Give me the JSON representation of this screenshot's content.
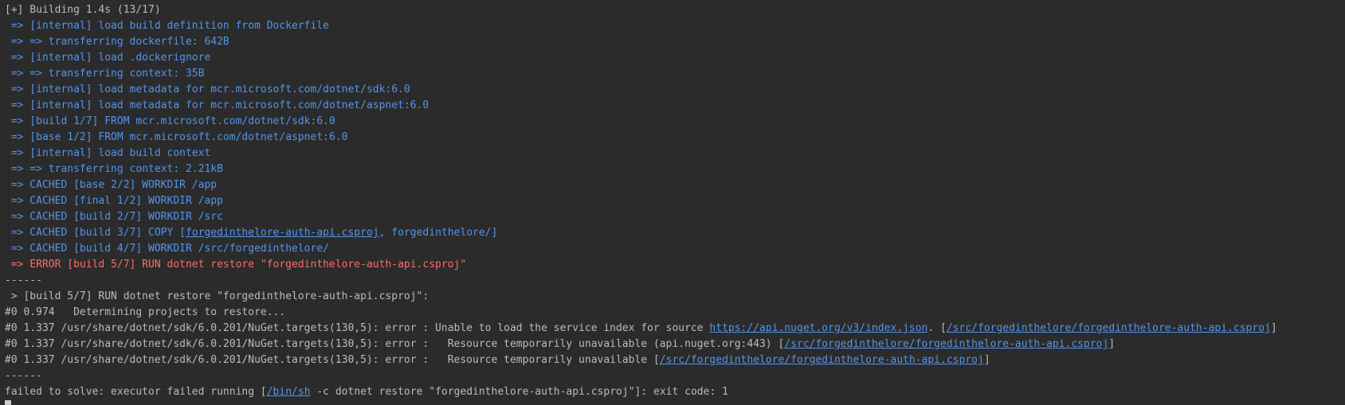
{
  "terminal": {
    "clipped_top": {
      "text": "",
      "link_stub": "",
      "tail": ""
    },
    "header": "[+] Building 1.4s (13/17)",
    "steps": [
      " => [internal] load build definition from Dockerfile",
      " => => transferring dockerfile: 642B",
      " => [internal] load .dockerignore",
      " => => transferring context: 35B",
      " => [internal] load metadata for mcr.microsoft.com/dotnet/sdk:6.0",
      " => [internal] load metadata for mcr.microsoft.com/dotnet/aspnet:6.0",
      " => [build 1/7] FROM mcr.microsoft.com/dotnet/sdk:6.0",
      " => [base 1/2] FROM mcr.microsoft.com/dotnet/aspnet:6.0",
      " => [internal] load build context",
      " => => transferring context: 2.21kB",
      " => CACHED [base 2/2] WORKDIR /app",
      " => CACHED [final 1/2] WORKDIR /app",
      " => CACHED [build 2/7] WORKDIR /src"
    ],
    "copy_step": {
      "prefix": " => CACHED [build 3/7] COPY [",
      "link": "forgedinthelore-auth-api.csproj",
      "suffix": ", forgedinthelore/]"
    },
    "step_workdir": " => CACHED [build 4/7] WORKDIR /src/forgedinthelore/",
    "error_step": " => ERROR [build 5/7] RUN dotnet restore \"forgedinthelore-auth-api.csproj\"",
    "separator": "------",
    "detail_header": " > [build 5/7] RUN dotnet restore \"forgedinthelore-auth-api.csproj\":",
    "detail_line1": "#0 0.974   Determining projects to restore...",
    "detail_line2": {
      "prefix": "#0 1.337 /usr/share/dotnet/sdk/6.0.201/NuGet.targets(130,5): error : Unable to load the service index for source ",
      "url": "https://api.nuget.org/v3/index.json",
      "middle": ". [",
      "path": "/src/forgedinthelore/forgedinthelore-auth-api.csproj",
      "end": "]"
    },
    "detail_line3": {
      "prefix": "#0 1.337 /usr/share/dotnet/sdk/6.0.201/NuGet.targets(130,5): error :   Resource temporarily unavailable (api.nuget.org:443) [",
      "path": "/src/forgedinthelore/forgedinthelore-auth-api.csproj",
      "end": "]"
    },
    "detail_line4": {
      "prefix": "#0 1.337 /usr/share/dotnet/sdk/6.0.201/NuGet.targets(130,5): error :   Resource temporarily unavailable [",
      "path": "/src/forgedinthelore/forgedinthelore-auth-api.csproj",
      "end": "]"
    },
    "separator2": "------",
    "failed": {
      "prefix": "failed to solve: executor failed running [",
      "link": "/bin/sh",
      "suffix": " -c dotnet restore \"forgedinthelore-auth-api.csproj\"]: exit code: 1"
    },
    "colors": {
      "background": "#2b2b2b",
      "text": "#bbbbbb",
      "blue": "#5394ec",
      "red": "#ff6b68"
    }
  }
}
